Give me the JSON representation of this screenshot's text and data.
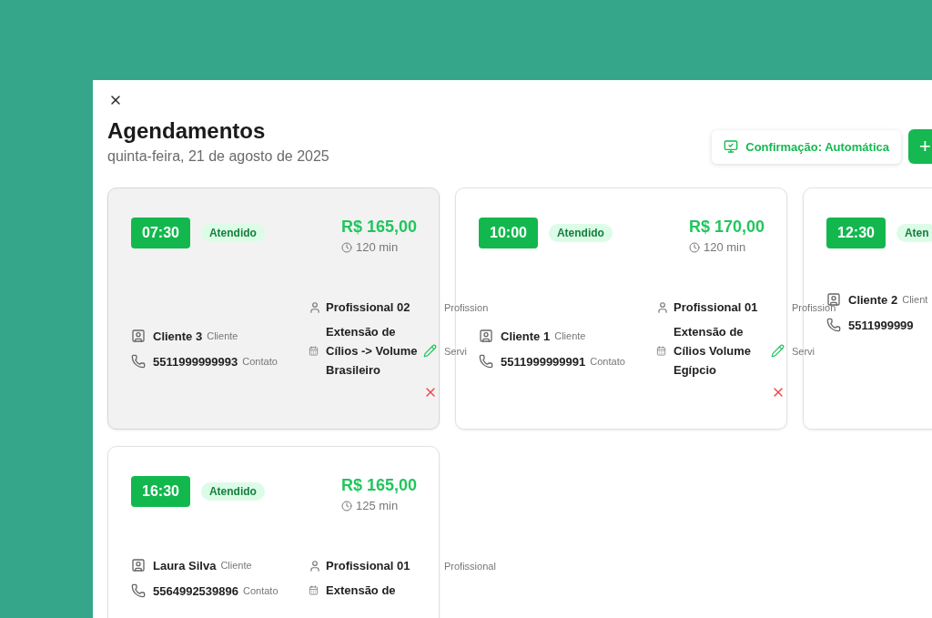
{
  "title": "Agendamentos",
  "subtitle": "quinta-feira, 21 de agosto de 2025",
  "confirm_button": "Confirmação: Automática",
  "add_button": "+",
  "appointments": [
    {
      "selected": true,
      "time": "07:30",
      "status": "Atendido",
      "price": "R$ 165,00",
      "duration": "120 min",
      "client": "Cliente 3",
      "client_label": "Cliente",
      "phone": "5511999999993",
      "phone_label": "Contato",
      "professional": "Profissional 02",
      "professional_label": "Profission",
      "service": "Extensão de Cílios -> Volume Brasileiro",
      "service_label": "Servi",
      "actions_visible": true
    },
    {
      "selected": false,
      "time": "10:00",
      "status": "Atendido",
      "price": "R$ 170,00",
      "duration": "120 min",
      "client": "Cliente 1",
      "client_label": "Cliente",
      "phone": "5511999999991",
      "phone_label": "Contato",
      "professional": "Profissional 01",
      "professional_label": "Profission",
      "service": "Extensão de Cílios Volume Egípcio",
      "service_label": "Servi",
      "actions_visible": true
    },
    {
      "selected": false,
      "time": "12:30",
      "status": "Aten",
      "client": "Cliente 2",
      "client_label": "Client",
      "phone": "5511999999",
      "actions_visible": false
    },
    {
      "selected": false,
      "time": "16:30",
      "status": "Atendido",
      "price": "R$ 165,00",
      "duration": "125 min",
      "client": "Laura Silva",
      "client_label": "Cliente",
      "phone": "5564992539896",
      "phone_label": "Contato",
      "professional": "Profissional 01",
      "professional_label": "Profissional",
      "service": "Extensão de",
      "actions_visible": false
    }
  ]
}
